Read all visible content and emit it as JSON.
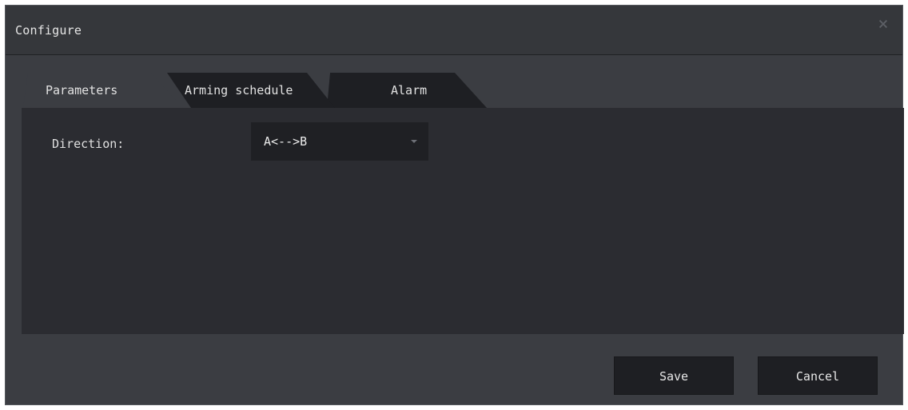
{
  "dialog": {
    "title": "Configure",
    "close_icon": "close-icon"
  },
  "tabs": [
    {
      "label": "Parameters",
      "active": true
    },
    {
      "label": "Arming schedule",
      "active": false
    },
    {
      "label": "Alarm",
      "active": false
    }
  ],
  "parameters": {
    "direction_label": "Direction:",
    "direction_value": "A<-->B"
  },
  "buttons": {
    "save_label": "Save",
    "cancel_label": "Cancel"
  },
  "colors": {
    "dialog_bg": "#3b3d42",
    "panel_bg": "#2b2c31",
    "active_tab": "#3b3d42",
    "inactive_tab": "#1e1f23",
    "button_bg": "#1e1f23"
  }
}
